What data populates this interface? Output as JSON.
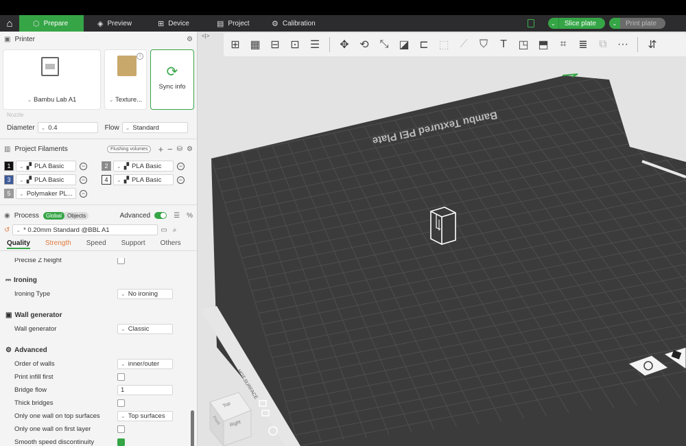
{
  "nav": {
    "tabs": [
      {
        "label": "Prepare",
        "icon": "cube-icon"
      },
      {
        "label": "Preview",
        "icon": "layers-icon"
      },
      {
        "label": "Device",
        "icon": "device-icon"
      },
      {
        "label": "Project",
        "icon": "project-icon"
      },
      {
        "label": "Calibration",
        "icon": "calibration-icon"
      }
    ],
    "slice_label": "Slice plate",
    "print_label": "Print plate"
  },
  "printer": {
    "title": "Printer",
    "printer_name": "Bambu Lab A1",
    "plate_type": "Texture...",
    "sync_label": "Sync info",
    "nozzle_label": "Nozzle",
    "diameter_label": "Diameter",
    "diameter_value": "0.4",
    "flow_label": "Flow",
    "flow_value": "Standard"
  },
  "filaments": {
    "title": "Project Filaments",
    "flushing_label": "Flushing volumes",
    "items": [
      {
        "num": "1",
        "name": "PLA Basic",
        "color": "#111111"
      },
      {
        "num": "2",
        "name": "PLA Basic",
        "color": "#8a8a8a"
      },
      {
        "num": "3",
        "name": "PLA Basic",
        "color": "#3c5a9a"
      },
      {
        "num": "4",
        "name": "PLA Basic",
        "color": "#ffffff"
      },
      {
        "num": "5",
        "name": "Polymaker PL...",
        "color": "#9a9a9a"
      }
    ]
  },
  "process": {
    "title": "Process",
    "global_label": "Global",
    "objects_label": "Objects",
    "advanced_label": "Advanced",
    "preset": "* 0.20mm Standard @BBL A1",
    "tabs": [
      "Quality",
      "Strength",
      "Speed",
      "Support",
      "Others"
    ]
  },
  "settings": {
    "precise_z_label": "Precise Z height",
    "ironing_group": "Ironing",
    "ironing_type_label": "Ironing Type",
    "ironing_type_value": "No ironing",
    "wall_gen_group": "Wall generator",
    "wall_gen_label": "Wall generator",
    "wall_gen_value": "Classic",
    "advanced_group": "Advanced",
    "order_walls_label": "Order of walls",
    "order_walls_value": "inner/outer",
    "print_infill_first_label": "Print infill first",
    "bridge_flow_label": "Bridge flow",
    "bridge_flow_value": "1",
    "thick_bridges_label": "Thick bridges",
    "one_wall_top_label": "Only one wall on top surfaces",
    "one_wall_top_value": "Top surfaces",
    "one_wall_first_label": "Only one wall on first layer",
    "smooth_speed_label": "Smooth speed discontinuity"
  },
  "viewport": {
    "plate_text": "Bambu Textured PEI Plate",
    "hot_surface": "HOT SURFACE",
    "cube_top": "Top",
    "cube_front": "Front",
    "cube_right": "Right"
  },
  "colors": {
    "accent": "#35a546",
    "plate": "#3b3b3b",
    "grid": "#4e4e4e"
  }
}
